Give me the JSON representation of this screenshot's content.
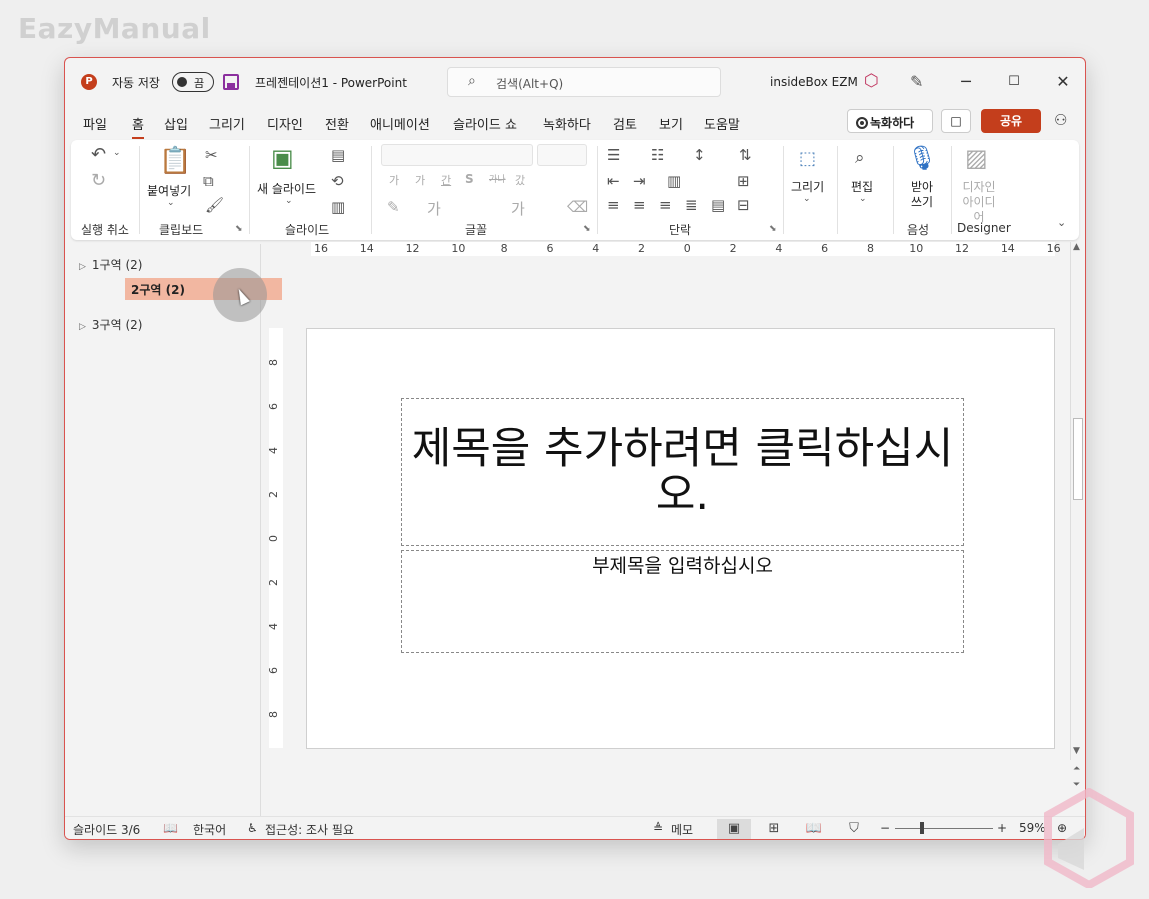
{
  "watermark": "EazyManual",
  "titlebar": {
    "app_icon": "P",
    "autosave_label": "자동 저장",
    "autosave_state": "끔",
    "doc_title": "프레젠테이션1  -  PowerPoint",
    "search_placeholder": "검색(Alt+Q)",
    "user": "insideBox EZM",
    "minimize": "─",
    "maximize": "☐",
    "close": "✕"
  },
  "tabs": [
    "파일",
    "홈",
    "삽입",
    "그리기",
    "디자인",
    "전환",
    "애니메이션",
    "슬라이드 쇼",
    "녹화하다",
    "검토",
    "보기",
    "도움말"
  ],
  "active_tab": "홈",
  "actions": {
    "record": "녹화하다",
    "comment": "□",
    "share": "공유"
  },
  "ribbon": {
    "groups": {
      "undo": "실행 취소",
      "clipboard": "클립보드",
      "slides": "슬라이드",
      "font": "글꼴",
      "paragraph": "단락",
      "voice": "음성",
      "designer": "Designer"
    },
    "paste": "붙여넣기",
    "new_slide": "새 슬라이드",
    "draw": "그리기",
    "edit": "편집",
    "dictate": "받아 쓰기",
    "design_ideas": "디자인 아이디어",
    "font_glyphs": [
      "가",
      "가",
      "간",
      "S",
      "가나",
      "갔"
    ]
  },
  "outline": {
    "sections": [
      {
        "label": "1구역 (2)"
      },
      {
        "label": "2구역 (2)",
        "selected": true
      },
      {
        "label": "3구역 (2)"
      }
    ]
  },
  "ruler": {
    "h_labels": [
      "16",
      "14",
      "12",
      "10",
      "8",
      "6",
      "4",
      "2",
      "0",
      "2",
      "4",
      "6",
      "8",
      "10",
      "12",
      "14",
      "16"
    ],
    "v_labels": [
      "8",
      "6",
      "4",
      "2",
      "0",
      "2",
      "4",
      "6",
      "8"
    ]
  },
  "slide": {
    "title_placeholder": "제목을 추가하려면 클릭하십시오.",
    "subtitle_placeholder": "부제목을 입력하십시오"
  },
  "status": {
    "slide_counter": "슬라이드 3/6",
    "language": "한국어",
    "accessibility": "접근성: 조사 필요",
    "notes": "메모",
    "zoom_minus": "−",
    "zoom_plus": "+",
    "zoom": "59%",
    "zoom_level": 0.59
  },
  "colors": {
    "accent": "#c43e1c",
    "selected_section": "#f2b7a1",
    "window_border": "#d9534f"
  }
}
